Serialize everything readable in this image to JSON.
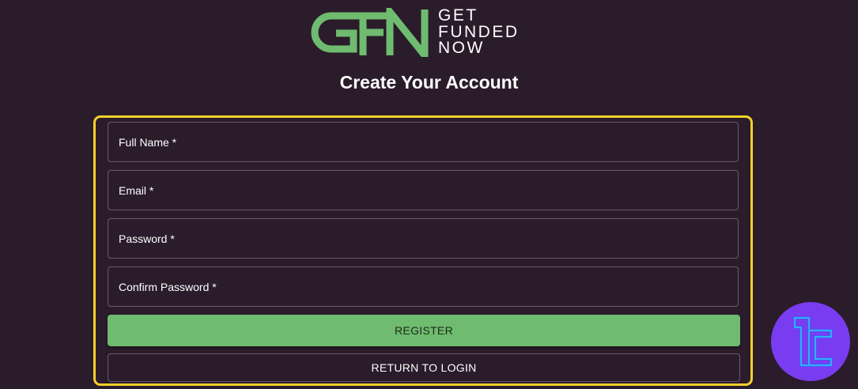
{
  "brand": {
    "logo_mark": "GFN",
    "logo_lines": [
      "GET",
      "FUNDED",
      "NOW"
    ],
    "logo_color": "#6fbb6f"
  },
  "page": {
    "title": "Create Your Account"
  },
  "form": {
    "fields": [
      {
        "label": "Full Name *",
        "value": ""
      },
      {
        "label": "Email *",
        "value": ""
      },
      {
        "label": "Password *",
        "value": ""
      },
      {
        "label": "Confirm Password *",
        "value": ""
      }
    ],
    "register_label": "REGISTER",
    "return_label": "RETURN TO LOGIN",
    "highlight_color": "#f7d02a"
  },
  "watermark": {
    "icon": "tradingfinder-logo-icon",
    "color": "#7a3cf0"
  }
}
